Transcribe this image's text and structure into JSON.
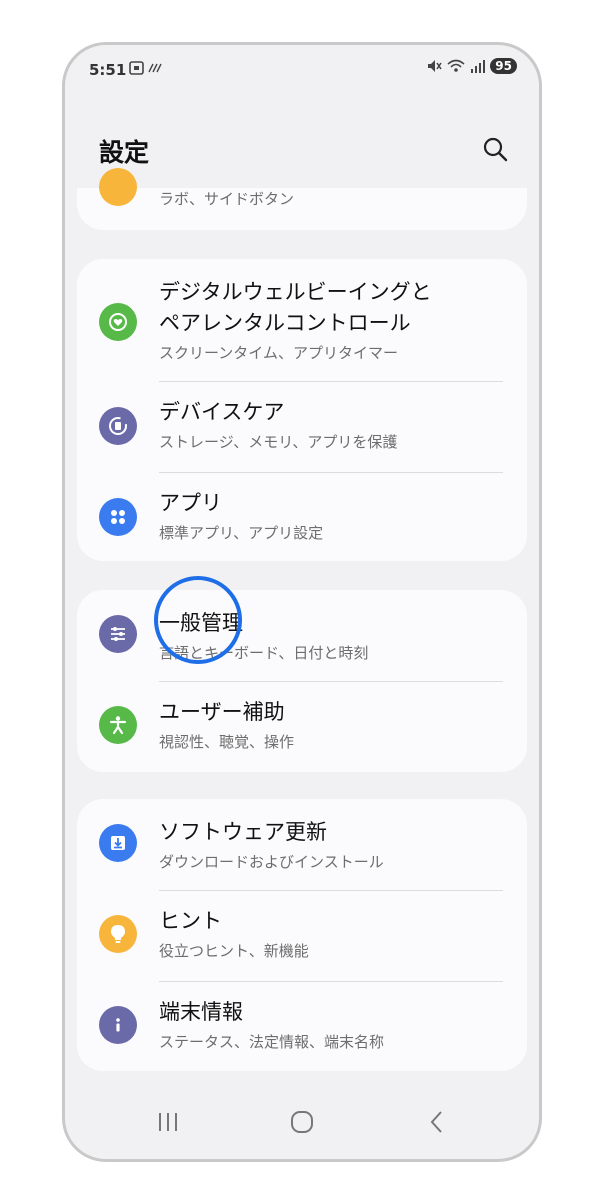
{
  "status_bar": {
    "time": "5:51",
    "battery": "95"
  },
  "header": {
    "title": "設定"
  },
  "colors": {
    "green": "#56b948",
    "purple": "#6b6aa8",
    "blue": "#3a7bf0",
    "orange": "#f7b53c",
    "highlight": "#1e6ee8"
  },
  "partial_item": {
    "subtitle": "ラボ、サイドボタン"
  },
  "group1": {
    "items": [
      {
        "title_line1": "デジタルウェルビーイングと",
        "title_line2": "ペアレンタルコントロール",
        "subtitle": "スクリーンタイム、アプリタイマー",
        "icon": "digital-wellbeing-icon"
      },
      {
        "title": "デバイスケア",
        "subtitle": "ストレージ、メモリ、アプリを保護",
        "icon": "device-care-icon"
      },
      {
        "title": "アプリ",
        "subtitle": "標準アプリ、アプリ設定",
        "icon": "apps-icon"
      }
    ]
  },
  "group2": {
    "items": [
      {
        "title": "一般管理",
        "subtitle": "言語とキーボード、日付と時刻",
        "icon": "general-management-icon"
      },
      {
        "title": "ユーザー補助",
        "subtitle": "視認性、聴覚、操作",
        "icon": "accessibility-icon"
      }
    ]
  },
  "group3": {
    "items": [
      {
        "title": "ソフトウェア更新",
        "subtitle": "ダウンロードおよびインストール",
        "icon": "software-update-icon"
      },
      {
        "title": "ヒント",
        "subtitle": "役立つヒント、新機能",
        "icon": "tips-icon"
      },
      {
        "title": "端末情報",
        "subtitle": "ステータス、法定情報、端末名称",
        "icon": "about-phone-icon"
      }
    ]
  }
}
